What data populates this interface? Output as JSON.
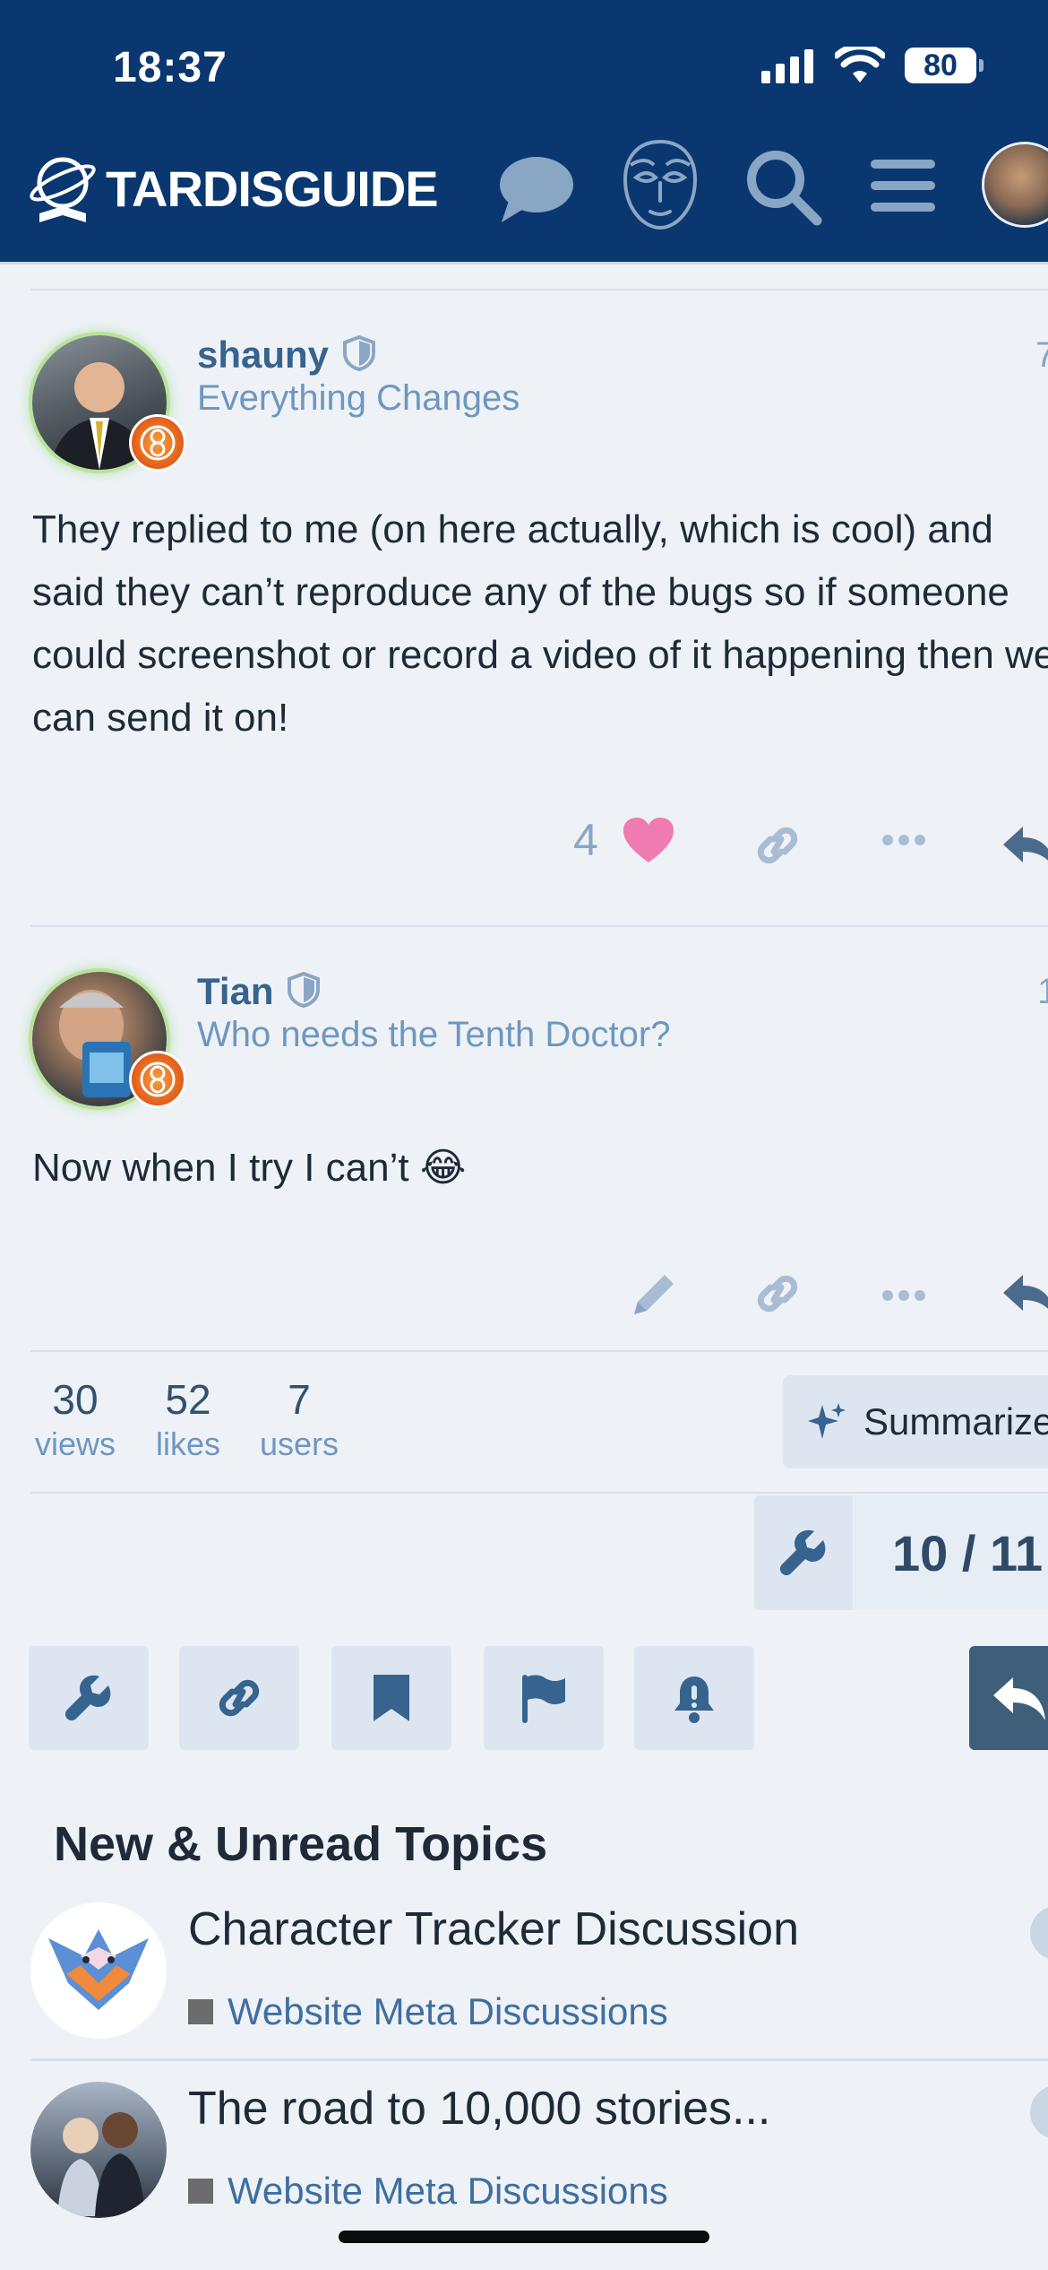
{
  "status": {
    "time": "18:37",
    "battery": "80"
  },
  "header": {
    "logo_text": "TARDISGUIDE"
  },
  "posts": [
    {
      "username": "shauny",
      "user_title": "Everything Changes",
      "date_fragment": "7",
      "body": "They replied to me (on here actually, which is cool) and said they can’t reproduce any of the bugs so if someone could screenshot or record a video of it happening then we can send it on!",
      "likes": "4"
    },
    {
      "username": "Tian",
      "user_title": "Who needs the Tenth Doctor?",
      "date_fragment": "1",
      "body": "Now when I try I can’t 😂"
    }
  ],
  "stats": [
    {
      "value": "30",
      "label": "views"
    },
    {
      "value": "52",
      "label": "likes"
    },
    {
      "value": "7",
      "label": "users"
    }
  ],
  "summarize_label": "Summarize",
  "progress": {
    "text": "10 / 11"
  },
  "topics_section": {
    "title": "New & Unread Topics",
    "items": [
      {
        "title": "Character Tracker Discussion",
        "category": "Website Meta Discussions"
      },
      {
        "title": "The road to 10,000 stories...",
        "category": "Website Meta Discussions"
      }
    ]
  },
  "colors": {
    "header_bg": "#0a3770",
    "like_heart": "#f07bb0",
    "link": "#3f6fa1",
    "page_bg": "#eef2f7"
  }
}
